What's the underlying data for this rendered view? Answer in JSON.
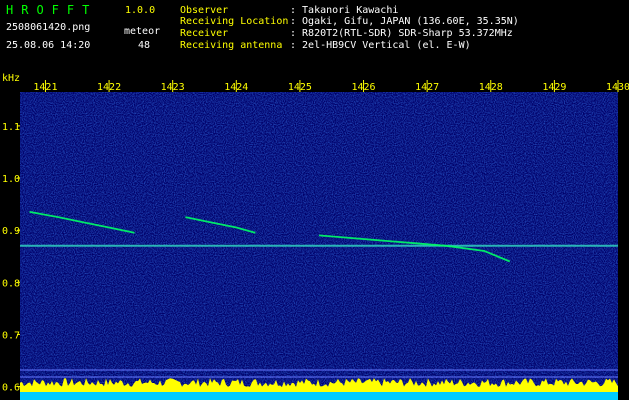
{
  "app": {
    "title": "HROFFT",
    "version": "1.0.0"
  },
  "file": {
    "name": "2508061420.png",
    "datetime": "25.08.06 14:20"
  },
  "meteor": {
    "label": "meteor",
    "count": "48"
  },
  "info": [
    {
      "label": "Observer",
      "value": ": Takanori Kawachi"
    },
    {
      "label": "Receiving Location",
      "value": ": Ogaki, Gifu, JAPAN (136.60E, 35.35N)"
    },
    {
      "label": "Receiver",
      "value": ": R820T2(RTL-SDR) SDR-Sharp 53.372MHz"
    },
    {
      "label": "Receiving antenna",
      "value": ": 2el-HB9CV Vertical (el. E-W)"
    }
  ],
  "colors": {
    "title": "#00ff00",
    "version": "#ffff00",
    "meta": "#ffffff",
    "label": "#ffff00",
    "value": "#ffffff",
    "tick": "#ffff00",
    "background": "#000000",
    "noise": "#00008c",
    "signal": "#00ff66",
    "level_fill": "#ffff00",
    "level_base": "#00ccff"
  },
  "chart_data": {
    "type": "heatmap",
    "y_unit_label": "kHz",
    "x_ticks": [
      "1421",
      "1422",
      "1423",
      "1424",
      "1425",
      "1426",
      "1427",
      "1428",
      "1429",
      "1430"
    ],
    "x_range": [
      1420.6,
      1430.0
    ],
    "y_ticks": [
      "1.1",
      "1.0",
      "0.9",
      "0.8",
      "0.7",
      "0.6"
    ],
    "y_range": [
      0.58,
      1.165
    ],
    "carrier_khz": 0.87,
    "meteor_traces": [
      {
        "x": [
          1420.75,
          1421.2,
          1421.6,
          1422.0,
          1422.4
        ],
        "y": [
          0.935,
          0.925,
          0.915,
          0.905,
          0.895
        ]
      },
      {
        "x": [
          1423.2,
          1423.6,
          1424.0,
          1424.3
        ],
        "y": [
          0.925,
          0.915,
          0.905,
          0.895
        ]
      },
      {
        "x": [
          1425.3,
          1425.8,
          1426.3,
          1426.8,
          1427.3,
          1427.9,
          1428.3
        ],
        "y": [
          0.89,
          0.885,
          0.88,
          0.875,
          0.87,
          0.86,
          0.84
        ]
      }
    ]
  }
}
